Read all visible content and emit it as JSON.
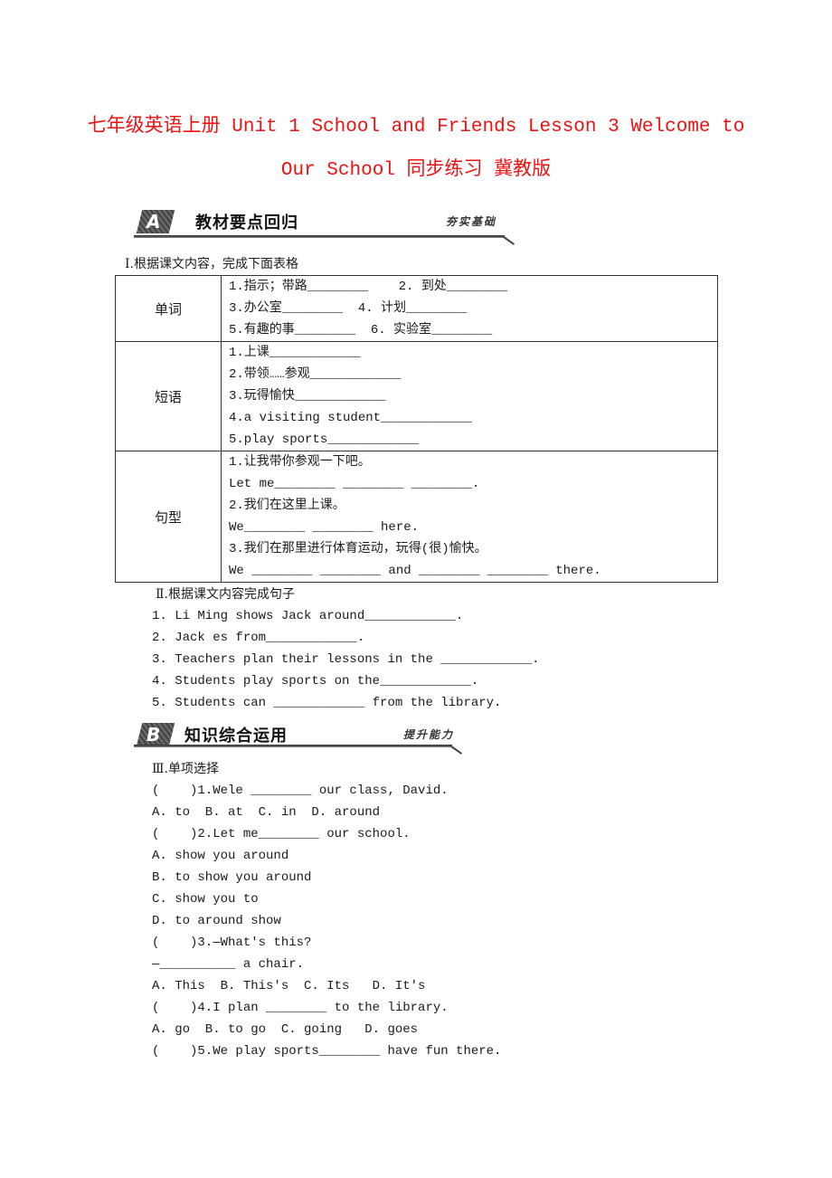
{
  "title": {
    "line1": "七年级英语上册 Unit 1 School and Friends Lesson 3 Welcome to",
    "line2": "Our School 同步练习 冀教版"
  },
  "section_a": {
    "badge": "A",
    "heading": "教材要点回归",
    "subheading": "夯实基础"
  },
  "part1": {
    "title": "Ⅰ.根据课文内容，完成下面表格",
    "rows": [
      {
        "label": "单词",
        "lines": [
          "1.指示；带路________    2. 到处________",
          "3.办公室________  4. 计划________",
          "5.有趣的事________  6. 实验室________"
        ]
      },
      {
        "label": "短语",
        "lines": [
          "1.上课____________",
          "2.带领……参观____________",
          "3.玩得愉快____________",
          "4.a visiting student____________",
          "5.play sports____________"
        ]
      },
      {
        "label": "句型",
        "lines": [
          "1.让我带你参观一下吧。",
          "Let me________ ________ ________.",
          "2.我们在这里上课。",
          "We________ ________ here.",
          "3.我们在那里进行体育运动，玩得(很)愉快。",
          "We ________ ________ and ________ ________ there."
        ]
      }
    ]
  },
  "part2": {
    "title": "Ⅱ.根据课文内容完成句子",
    "items": [
      "1. Li Ming shows Jack around____________.",
      "2. Jack es from____________.",
      "3. Teachers plan their lessons in the ____________.",
      "4. Students play sports on the____________.",
      "5. Students can ____________ from the library."
    ]
  },
  "section_b": {
    "badge": "B",
    "heading": "知识综合运用",
    "subheading": "提升能力"
  },
  "part3": {
    "title": "Ⅲ.单项选择",
    "lines": [
      "(    )1.Wele ________ our class, David.",
      "A. to  B. at  C. in  D. around",
      "(    )2.Let me________ our school.",
      "A. show you around",
      "B. to show you around",
      "C. show you to",
      "D. to around show",
      "(    )3.—What's this?",
      "—__________ a chair.",
      "A. This  B. This's  C. Its   D. It's",
      "(    )4.I plan ________ to the library.",
      "A. go  B. to go  C. going   D. goes",
      "(    )5.We play sports________ have fun there."
    ]
  }
}
